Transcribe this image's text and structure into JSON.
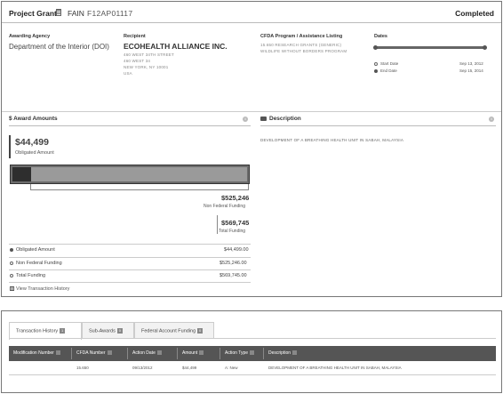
{
  "header": {
    "award_type": "Project Grant",
    "fain_label": "FAIN",
    "fain": "F12AP01117",
    "status": "Completed"
  },
  "overview": {
    "awarding_agency_label": "Awarding Agency",
    "awarding_agency": "Department of the Interior (DOI)",
    "recipient_label": "Recipient",
    "recipient_name": "ECOHEALTH ALLIANCE INC.",
    "recipient_address_1": "460 WEST 34TH STREET",
    "recipient_address_2": "460 WEST 34",
    "recipient_address_3": "NEW YORK, NY 10001",
    "recipient_country": "USA",
    "cfda_label": "CFDA Program / Assistance Listing",
    "cfda_line_1": "15.650 RESEARCH GRANTS (GENERIC)",
    "cfda_line_2": "WILDLIFE WITHOUT BORDERS PROGRAM",
    "dates_label": "Dates",
    "start_date_label": "Start Date",
    "start_date": "Sep 13, 2012",
    "end_date_label": "End Date",
    "end_date": "Sep 15, 2014"
  },
  "award_amounts": {
    "title": "$ Award Amounts",
    "obligated_amount": "$44,499",
    "obligated_caption": "Obligated Amount",
    "non_federal_amount": "$525,246",
    "non_federal_caption": "Non Federal Funding",
    "total_amount": "$569,745",
    "total_caption": "Total Funding",
    "obligated_share": 0.078,
    "rows": [
      {
        "label": "Obligated Amount",
        "value": "$44,499.00"
      },
      {
        "label": "Non Federal Funding",
        "value": "$525,246.00"
      },
      {
        "label": "Total Funding",
        "value": "$569,745.00"
      }
    ],
    "view_history_link": "View Transaction History"
  },
  "description": {
    "title": "Description",
    "text": "DEVELOPMENT OF A BREATHING HEALTH UNIT IN SABAH, MALAYSIA"
  },
  "transactions": {
    "tabs": [
      {
        "label": "Transaction History",
        "badge": "1"
      },
      {
        "label": "Sub-Awards",
        "badge": "0"
      },
      {
        "label": "Federal Account Funding",
        "badge": "0"
      }
    ],
    "columns": [
      "Modification Number",
      "CFDA Number",
      "Action Date",
      "Amount",
      "Action Type",
      "Description"
    ],
    "rows": [
      [
        "",
        "15.650",
        "09/13/2012",
        "$44,499",
        "A: New",
        "DEVELOPMENT OF A BREATHING HEALTH UNIT IN SABAH, MALAYSIA"
      ]
    ]
  }
}
